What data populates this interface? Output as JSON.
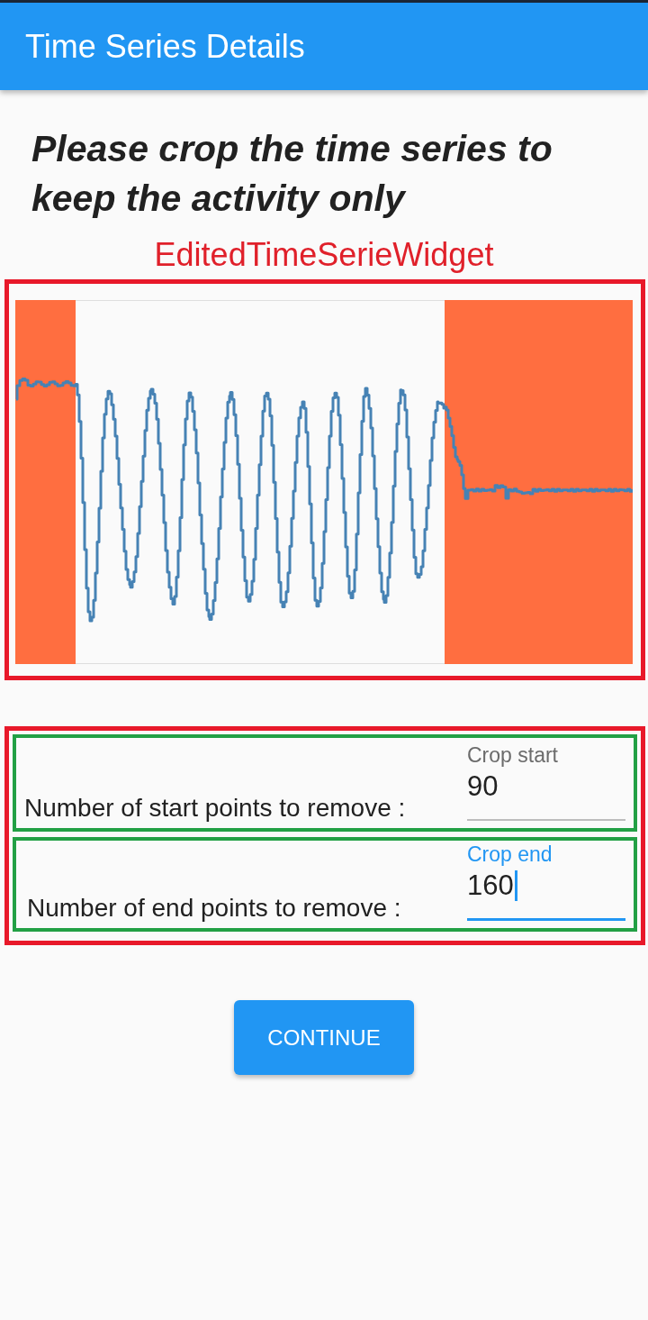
{
  "app_bar": {
    "title": "Time Series Details"
  },
  "instruction": "Please crop the time series to keep the activity only",
  "chart_widget": {
    "annotation_label": "EditedTimeSerieWidget"
  },
  "crop_form": {
    "rows": [
      {
        "prompt": "Number of start points to remove :",
        "field": {
          "label": "Crop start",
          "value": "90",
          "focused": false
        }
      },
      {
        "prompt": "Number of end points to remove :",
        "field": {
          "label": "Crop end",
          "value": "160",
          "focused": true
        }
      }
    ]
  },
  "continue_button": {
    "label": "CONTINUE"
  }
}
